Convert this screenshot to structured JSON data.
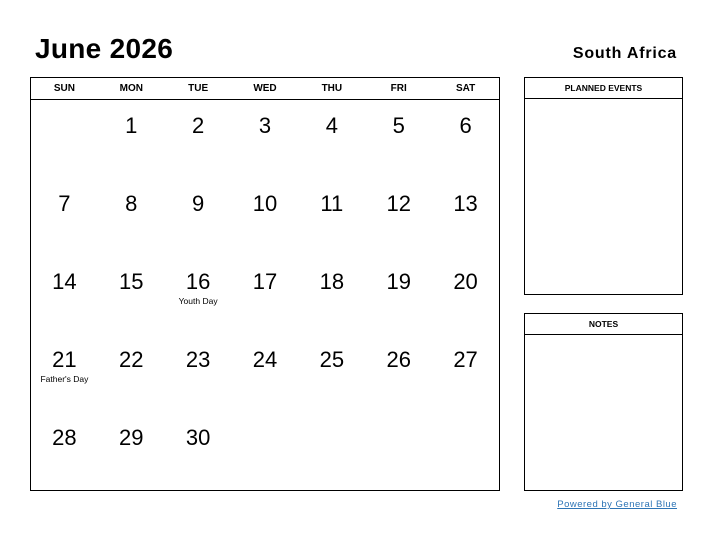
{
  "header": {
    "title": "June 2026",
    "country": "South Africa"
  },
  "calendar": {
    "weekdays": [
      "SUN",
      "MON",
      "TUE",
      "WED",
      "THU",
      "FRI",
      "SAT"
    ],
    "weeks": [
      [
        {
          "day": ""
        },
        {
          "day": "1"
        },
        {
          "day": "2"
        },
        {
          "day": "3"
        },
        {
          "day": "4"
        },
        {
          "day": "5"
        },
        {
          "day": "6"
        }
      ],
      [
        {
          "day": "7"
        },
        {
          "day": "8"
        },
        {
          "day": "9"
        },
        {
          "day": "10"
        },
        {
          "day": "11"
        },
        {
          "day": "12"
        },
        {
          "day": "13"
        }
      ],
      [
        {
          "day": "14"
        },
        {
          "day": "15"
        },
        {
          "day": "16",
          "holiday": "Youth Day"
        },
        {
          "day": "17"
        },
        {
          "day": "18"
        },
        {
          "day": "19"
        },
        {
          "day": "20"
        }
      ],
      [
        {
          "day": "21",
          "holiday": "Father's Day"
        },
        {
          "day": "22"
        },
        {
          "day": "23"
        },
        {
          "day": "24"
        },
        {
          "day": "25"
        },
        {
          "day": "26"
        },
        {
          "day": "27"
        }
      ],
      [
        {
          "day": "28"
        },
        {
          "day": "29"
        },
        {
          "day": "30"
        },
        {
          "day": ""
        },
        {
          "day": ""
        },
        {
          "day": ""
        },
        {
          "day": ""
        }
      ]
    ]
  },
  "sidebar": {
    "planned_events_label": "PLANNED EVENTS",
    "notes_label": "NOTES"
  },
  "footer": {
    "powered_by": "Powered by General Blue"
  }
}
